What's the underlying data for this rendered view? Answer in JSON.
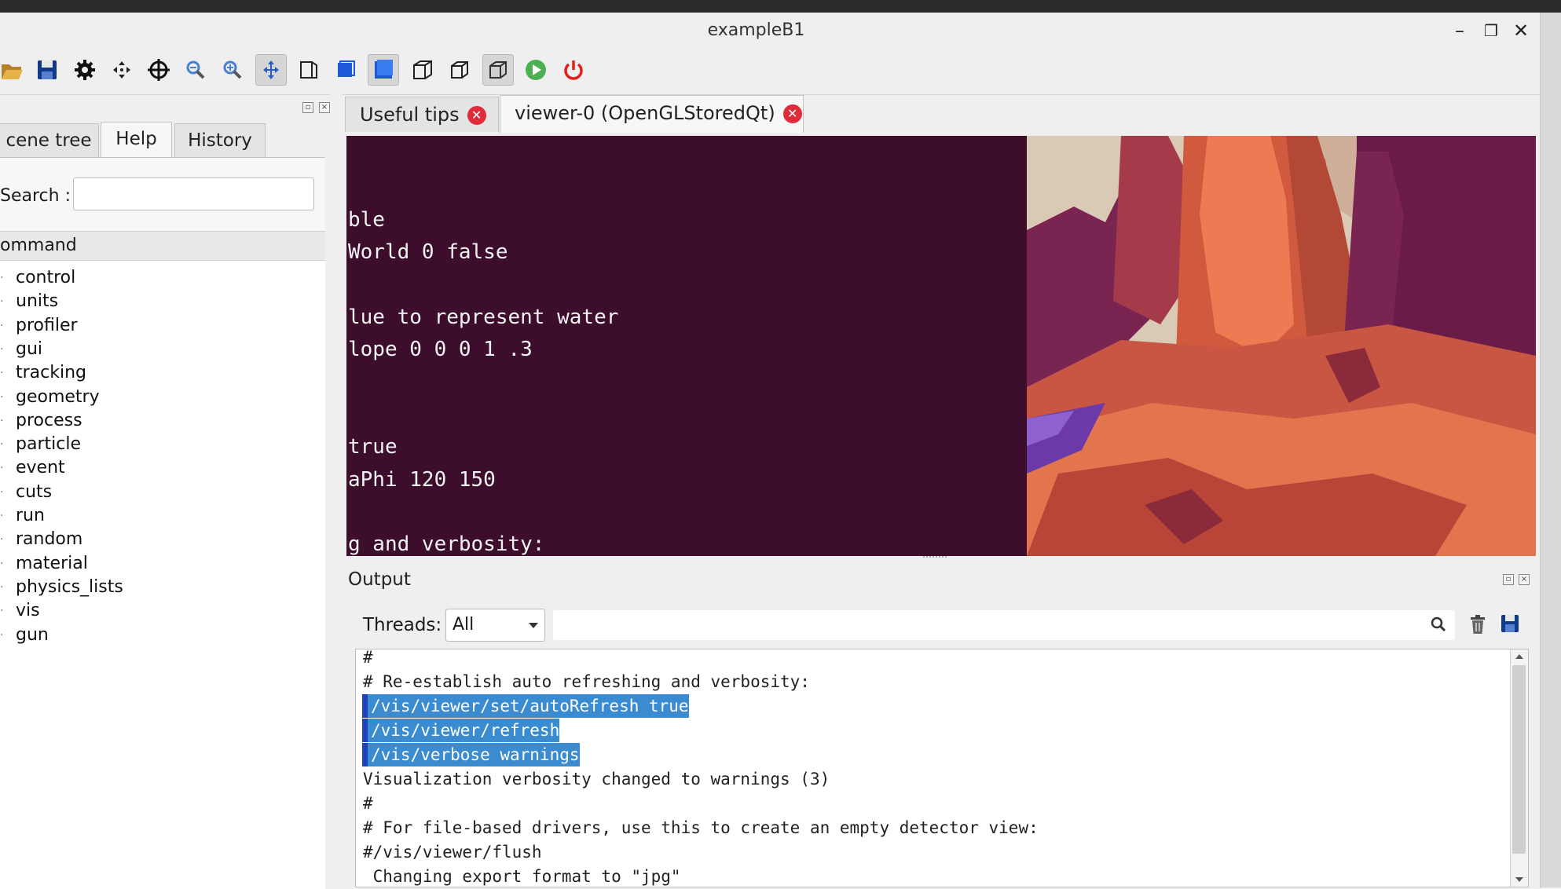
{
  "window": {
    "title": "exampleB1",
    "controls": [
      "minimize-icon",
      "restore-icon",
      "close-icon"
    ]
  },
  "toolbar": {
    "icons": [
      "open-folder-icon",
      "save-icon",
      "settings-gear-icon",
      "move-icon",
      "pick-crosshair-icon",
      "zoom-out-icon",
      "zoom-in-icon",
      "rotate-icon",
      "perspective-icon",
      "ortho-icon",
      "surface-style-icon",
      "wireframe-icon",
      "hidden-line-icon",
      "hidden-surface-icon",
      "run-icon",
      "exit-icon"
    ]
  },
  "left_tabs": {
    "scene_tree": "cene tree",
    "help": "Help",
    "history": "History"
  },
  "help": {
    "search_label": "Search :",
    "search_value": "",
    "command_header": "ommand",
    "commands": [
      "control",
      "units",
      "profiler",
      "gui",
      "tracking",
      "geometry",
      "process",
      "particle",
      "event",
      "cuts",
      "run",
      "random",
      "material",
      "physics_lists",
      "vis",
      "gun"
    ]
  },
  "right_tabs": {
    "useful_tips": "Useful tips",
    "viewer": "viewer-0 (OpenGLStoredQt)"
  },
  "viewer_terminal": [
    "ble",
    "World 0 false",
    "lue to represent water",
    "lope 0 0 0 1 .3",
    "true",
    "aPhi 120 150",
    "g and verbosity:"
  ],
  "output": {
    "title": "Output",
    "threads_label": "Threads:",
    "threads_value": "All",
    "filter_value": "",
    "lines": [
      "#",
      "# Re-establish auto refreshing and verbosity:",
      "/vis/viewer/set/autoRefresh true",
      "/vis/viewer/refresh",
      "/vis/verbose warnings",
      "Visualization verbosity changed to warnings (3)",
      "#",
      "# For file-based drivers, use this to create an empty detector view:",
      "#/vis/viewer/flush",
      " Changing export format to \"jpg\""
    ],
    "highlighted": [
      2,
      3,
      4
    ]
  },
  "colors": {
    "terminal_bg": "#3c0e2c",
    "selection": "#3b8bd1",
    "close_tab": "#e02b3a"
  }
}
